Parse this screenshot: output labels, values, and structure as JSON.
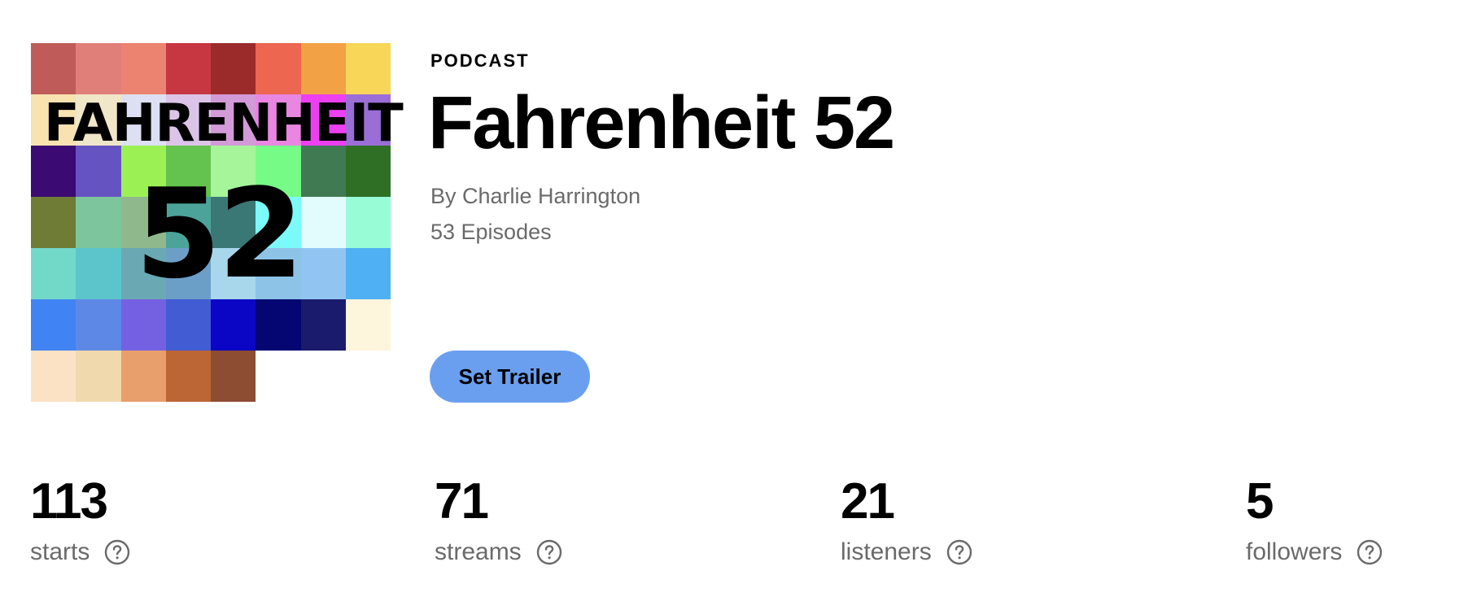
{
  "podcast": {
    "type_label": "PODCAST",
    "title": "Fahrenheit 52",
    "author": "By Charlie Harrington",
    "episodes": "53 Episodes"
  },
  "cover": {
    "word": "FAHRENHEIT",
    "number": "52",
    "colors": [
      [
        "#bf5c5a",
        "#e07e7a",
        "#ec8370",
        "#c73742",
        "#9b2b2b",
        "#ec6650",
        "#f2a245",
        "#f7d658"
      ],
      [
        "#f7e2b0",
        "#f0e6c8",
        "#dde0f2",
        "#dcc4e8",
        "#d39ad8",
        "#e886e2",
        "#ec3ff0",
        "#9a6ed6"
      ],
      [
        "#3b0a72",
        "#6553c2",
        "#9bf154",
        "#64c24e",
        "#a6f59a",
        "#76fb87",
        "#3f7a52",
        "#2f6e25"
      ],
      [
        "#6e7c36",
        "#7dc59c",
        "#8fb88c",
        "#4ca39a",
        "#3a7876",
        "#7cfafa",
        "#e2fbfd",
        "#98fdd6"
      ],
      [
        "#72d9c9",
        "#5cc5cc",
        "#6aa9b3",
        "#6c9fc8",
        "#a8d7eb",
        "#8dc3e6",
        "#92c4f2",
        "#4fb0f3"
      ],
      [
        "#4083f2",
        "#5e88e6",
        "#7461e1",
        "#425cd4",
        "#0b06c5",
        "#060673",
        "#1b1b6e",
        "#fdf5dc"
      ],
      [
        "#fbe2c4",
        "#f0d9ac",
        "#e89f6b",
        "#bc6535",
        "#8c4d32",
        "#ffffff",
        "#ffffff",
        "#ffffff"
      ]
    ]
  },
  "actions": {
    "set_trailer": "Set Trailer"
  },
  "stats": [
    {
      "value": "113",
      "label": "starts"
    },
    {
      "value": "71",
      "label": "streams"
    },
    {
      "value": "21",
      "label": "listeners"
    },
    {
      "value": "5",
      "label": "followers"
    }
  ],
  "icons": {
    "help": "question-circle-icon"
  }
}
